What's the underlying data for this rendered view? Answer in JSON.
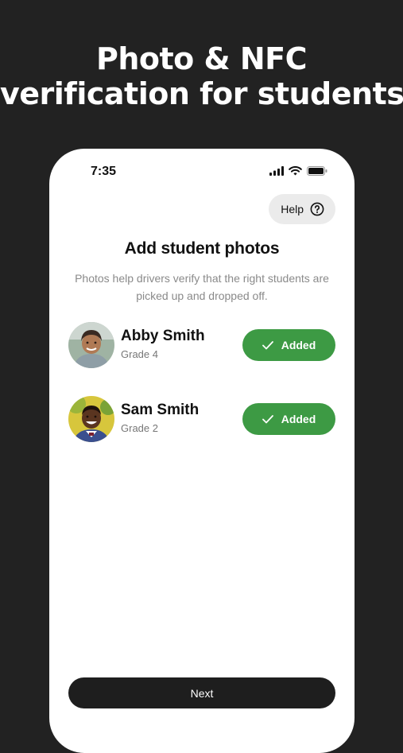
{
  "headline": {
    "line1": "Photo & NFC",
    "line2": "verification for students"
  },
  "status_bar": {
    "time": "7:35",
    "icons": [
      "signal-icon",
      "wifi-icon",
      "battery-icon"
    ]
  },
  "help_button": {
    "label": "Help",
    "icon": "question-circle-icon"
  },
  "title": "Add student photos",
  "subtitle": "Photos help drivers verify that the right students are picked up and dropped off.",
  "students": [
    {
      "name": "Abby Smith",
      "grade": "Grade 4",
      "status": "Added"
    },
    {
      "name": "Sam Smith",
      "grade": "Grade 2",
      "status": "Added"
    }
  ],
  "next_button": {
    "label": "Next"
  },
  "colors": {
    "accent_green": "#3d9a44",
    "background": "#222222",
    "button_dark": "#1e1e1e"
  }
}
